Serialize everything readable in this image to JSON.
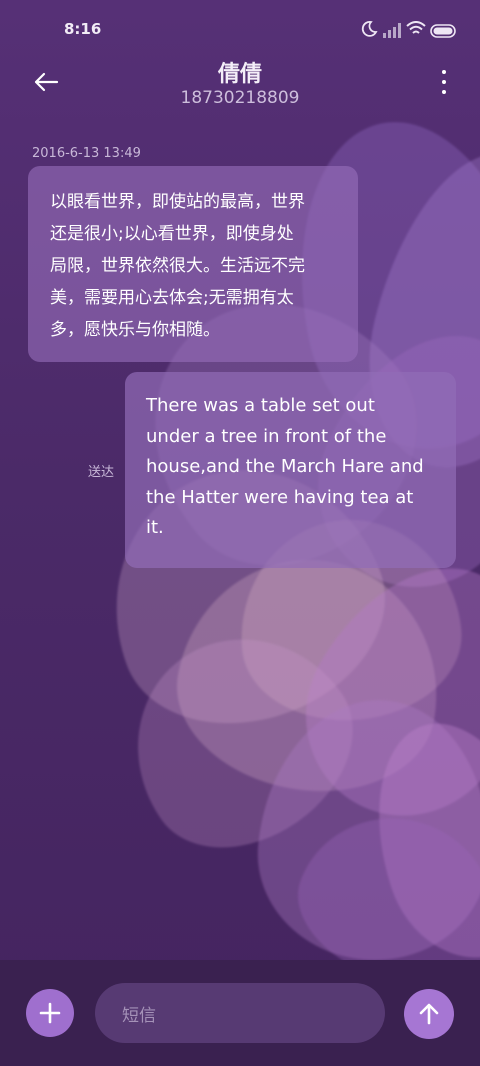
{
  "status_bar": {
    "time": "8:16",
    "icons": [
      "moon-icon",
      "signal-icon",
      "wifi-icon",
      "battery-icon"
    ]
  },
  "header": {
    "contact_name": "倩倩",
    "phone_number": "18730218809",
    "back_icon": "back-arrow-icon",
    "menu_icon": "more-vertical-icon"
  },
  "conversation": {
    "timestamp": "2016-6-13 13:49",
    "incoming_message": {
      "lines": [
        "以眼看世界，即使站的最高，世界",
        "还是很小;以心看世界，即使身处",
        "局限，世界依然很大。生活远不完",
        "美，需要用心去体会;无需拥有太",
        "多，愿快乐与你相随。"
      ]
    },
    "outgoing_message": {
      "lines": [
        "There was a table set out",
        "under a tree in front of the",
        "house,and the March Hare and",
        "the Hatter were having tea at",
        "it."
      ],
      "status": "送达"
    }
  },
  "composer": {
    "placeholder": "短信",
    "add_icon": "plus-icon",
    "send_icon": "send-arrow-up-icon"
  },
  "colors": {
    "background": "#4c2a66",
    "bubble": "#966eb9",
    "accent": "#a676d3",
    "composer_bar": "#3a2150"
  }
}
